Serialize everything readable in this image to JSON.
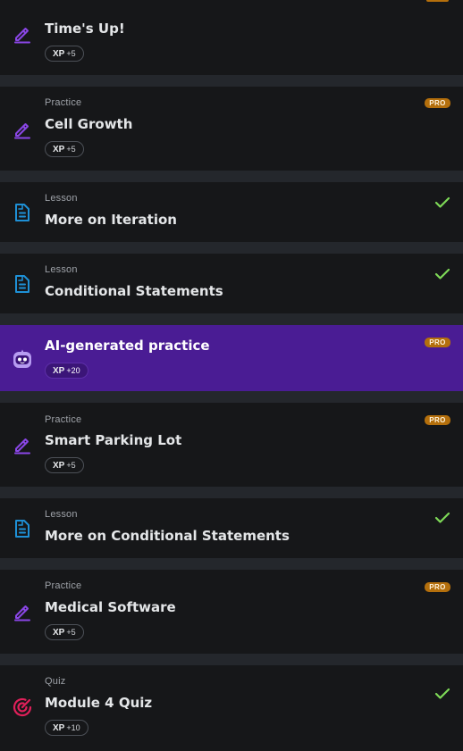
{
  "items": [
    {
      "type": "",
      "title": "Time's Up!",
      "xp_label": "XP",
      "xp_amount": "+5",
      "status": "pro"
    },
    {
      "type": "Practice",
      "title": "Cell Growth",
      "xp_label": "XP",
      "xp_amount": "+5",
      "status": "pro",
      "badge": "PRO"
    },
    {
      "type": "Lesson",
      "title": "More on Iteration",
      "status": "completed"
    },
    {
      "type": "Lesson",
      "title": "Conditional Statements",
      "status": "completed"
    },
    {
      "type": "",
      "title": "AI-generated practice",
      "xp_label": "XP",
      "xp_amount": "+20",
      "status": "pro",
      "badge": "PRO"
    },
    {
      "type": "Practice",
      "title": "Smart Parking Lot",
      "xp_label": "XP",
      "xp_amount": "+5",
      "status": "pro",
      "badge": "PRO"
    },
    {
      "type": "Lesson",
      "title": "More on Conditional Statements",
      "status": "completed"
    },
    {
      "type": "Practice",
      "title": "Medical Software",
      "xp_label": "XP",
      "xp_amount": "+5",
      "status": "pro",
      "badge": "PRO"
    },
    {
      "type": "Quiz",
      "title": "Module 4 Quiz",
      "xp_label": "XP",
      "xp_amount": "+10",
      "status": "completed"
    }
  ],
  "icons": {
    "practice": "pencil-icon",
    "lesson": "document-icon",
    "ai": "ai-bot-icon",
    "quiz": "target-icon",
    "completed": "checkmark-icon"
  },
  "colors": {
    "practice_icon": "#8a46e6",
    "lesson_icon": "#1e90d6",
    "quiz_icon": "#e0205a",
    "check": "#7ed957",
    "pro_badge": "#b46f0c",
    "ai_highlight": "#4a1c94"
  }
}
